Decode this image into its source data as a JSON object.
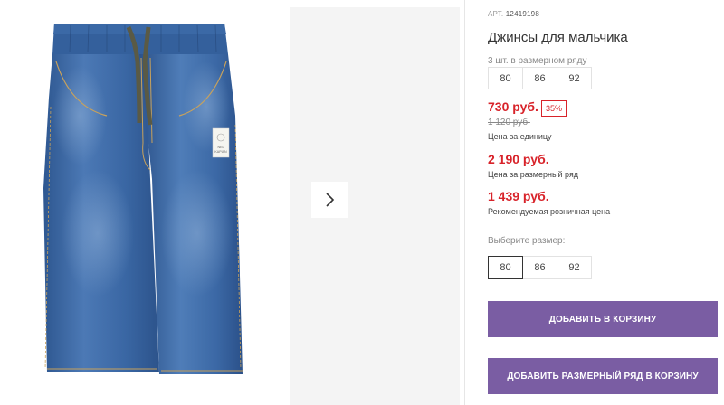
{
  "product": {
    "article_label": "АРТ.",
    "article_number": "12419198",
    "title": "Джинсы для мальчика",
    "row_count_text": "3 шт. в размерном ряду",
    "row_sizes": [
      "80",
      "86",
      "92"
    ],
    "price_unit": "730 руб.",
    "discount": "35%",
    "old_price": "1 120 руб.",
    "price_unit_caption": "Цена за единицу",
    "price_row": "2 190 руб.",
    "price_row_caption": "Цена за размерный ряд",
    "price_retail": "1 439 руб.",
    "price_retail_caption": "Рекомендуемая розничная цена",
    "choose_size_label": "Выберите размер:",
    "select_sizes": [
      "80",
      "86",
      "92"
    ],
    "selected_size": "80",
    "add_to_cart": "Добавить в корзину",
    "add_row_to_cart": "Добавить размерный ряд в корзину"
  },
  "gallery": {
    "label_tag_text": [
      "NEL",
      "KAPIAN"
    ],
    "next_icon": "chevron-right-icon"
  },
  "colors": {
    "price_red": "#d8232a",
    "button_purple": "#7a5da3",
    "denim": "#3d69a3"
  }
}
